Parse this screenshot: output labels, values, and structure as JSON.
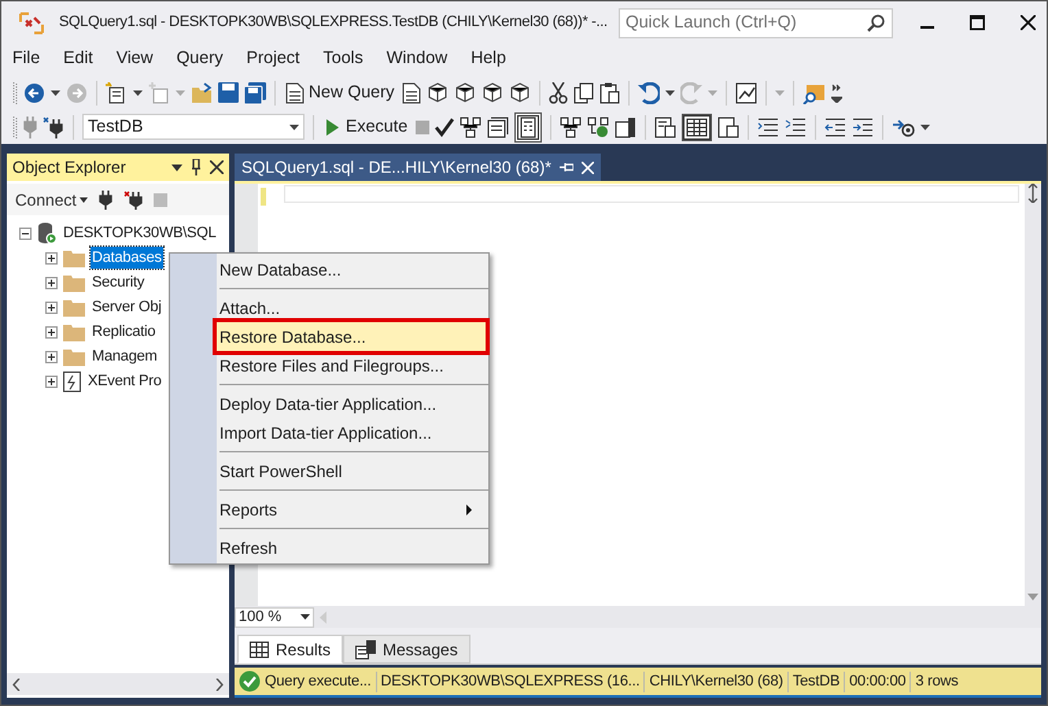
{
  "window": {
    "title": "SQLQuery1.sql - DESKTOPK30WB\\SQLEXPRESS.TestDB (CHILY\\Kernel30 (68))* -...",
    "quick_launch": {
      "placeholder": "Quick Launch (Ctrl+Q)"
    }
  },
  "menu": [
    "File",
    "Edit",
    "View",
    "Query",
    "Project",
    "Tools",
    "Window",
    "Help"
  ],
  "toolbar": {
    "new_query": "New Query",
    "database": "TestDB",
    "execute": "Execute"
  },
  "object_explorer": {
    "title": "Object Explorer",
    "connect": "Connect",
    "tree": [
      {
        "label": "DESKTOPK30WB\\SQL",
        "kind": "server",
        "expanded": true,
        "selected": false,
        "children": [
          {
            "label": "Databases",
            "kind": "folder",
            "expanded": false,
            "selected": true
          },
          {
            "label": "Security",
            "kind": "folder",
            "expanded": false,
            "selected": false
          },
          {
            "label": "Server Obj",
            "kind": "folder",
            "expanded": false,
            "selected": false
          },
          {
            "label": "Replicatio",
            "kind": "folder",
            "expanded": false,
            "selected": false
          },
          {
            "label": "Managem",
            "kind": "folder",
            "expanded": false,
            "selected": false
          },
          {
            "label": "XEvent Pro",
            "kind": "xevent",
            "expanded": false,
            "selected": false
          }
        ]
      }
    ]
  },
  "editor_tab": {
    "title": "SQLQuery1.sql - DE...HILY\\Kernel30 (68)*",
    "selected": true
  },
  "context_menu": {
    "groups": [
      [
        {
          "label": "New Database...",
          "selected": false,
          "marked": false,
          "submenu": false
        }
      ],
      [
        {
          "label": "Attach...",
          "selected": false,
          "marked": false,
          "submenu": false
        },
        {
          "label": "Restore Database...",
          "selected": true,
          "marked": true,
          "submenu": false
        },
        {
          "label": "Restore Files and Filegroups...",
          "selected": false,
          "marked": false,
          "submenu": false
        }
      ],
      [
        {
          "label": "Deploy Data-tier Application...",
          "selected": false,
          "marked": false,
          "submenu": false
        },
        {
          "label": "Import Data-tier Application...",
          "selected": false,
          "marked": false,
          "submenu": false
        }
      ],
      [
        {
          "label": "Start PowerShell",
          "selected": false,
          "marked": false,
          "submenu": false
        }
      ],
      [
        {
          "label": "Reports",
          "selected": false,
          "marked": false,
          "submenu": true
        }
      ],
      [
        {
          "label": "Refresh",
          "selected": false,
          "marked": false,
          "submenu": false
        }
      ]
    ]
  },
  "zoom": "100 %",
  "result_tabs": [
    {
      "label": "Results",
      "kind": "grid",
      "selected": true
    },
    {
      "label": "Messages",
      "kind": "messages",
      "selected": false
    }
  ],
  "status_bar": [
    {
      "text": "Query  execute...",
      "kind": "success"
    },
    {
      "text": "DESKTOPK30WB\\SQLEXPRESS (16...",
      "kind": "plain"
    },
    {
      "text": "CHILY\\Kernel30 (68)",
      "kind": "plain"
    },
    {
      "text": "TestDB",
      "kind": "plain"
    },
    {
      "text": "00:00:00",
      "kind": "plain"
    },
    {
      "text": "3 rows",
      "kind": "plain"
    }
  ]
}
